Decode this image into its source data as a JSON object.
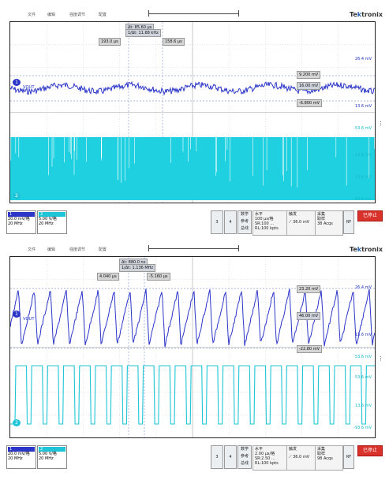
{
  "menu": [
    "文件",
    "编辑",
    "强度调节",
    "配置"
  ],
  "brand": {
    "prefix": "Te",
    "mark": "k",
    "suffix": "tronix"
  },
  "scopes": [
    {
      "delta_time": "Δt: 85.60 μs",
      "delta_freq": "1/Δt: 11.68 kHz",
      "cursor_a": "193.0 μs",
      "cursor_b": "158.6 μs",
      "v_a": "9.200 mV",
      "v_b": "-6.800 mV",
      "dv": "16.00 mV",
      "dv_dt": "ΔV/Δt",
      "ch1_name": "VOUT",
      "ch2_name": "CH2",
      "right_labels": [
        "26.4 mV",
        "Δt",
        "13.6 mV",
        "-53.6 mV",
        "-13.6 mV",
        "-13.6 mV",
        "-93.6 mV"
      ],
      "ch1": {
        "label": "20.0 mV/格",
        "bw": "20 MHz"
      },
      "ch2": {
        "label": "5.00 V/格",
        "bw": "20 MHz"
      },
      "btn3": "3",
      "btn4": "4",
      "math": [
        "数学",
        "参考",
        "总线"
      ],
      "horizontal": [
        "水平",
        "100 μs/格",
        "SR:100 ...",
        "RL:100 kpts"
      ],
      "trigger": [
        "触发",
        "36.0 mV"
      ],
      "acq": [
        "采集",
        "取样",
        "38 Acqs"
      ],
      "rf": "RF",
      "stop": "已停止"
    },
    {
      "delta_time": "Δt: 880.0 ns",
      "delta_freq": "1/Δt: 1.136 MHz",
      "cursor_a": "4.040 μs",
      "cursor_b": "-5.160 μs",
      "v_a": "23.20 mV",
      "v_b": "-22.80 mV",
      "dv": "46.00 mV",
      "dv_dt": "ΔV/Δt",
      "ch1_name": "VOUT",
      "ch2_name": "CH2",
      "right_labels": [
        "26.4 mV",
        "Δt",
        "13.6 mV",
        "53.6 mV",
        "53.6 mV",
        "13.6 mV",
        "-93.6 mV"
      ],
      "ch1": {
        "label": "20.0 mV/格",
        "bw": "20 MHz"
      },
      "ch2": {
        "label": "5.00 V/格",
        "bw": "20 MHz"
      },
      "btn3": "3",
      "btn4": "4",
      "math": [
        "数学",
        "参考",
        "总线"
      ],
      "horizontal": [
        "水平",
        "2.00 μs/格",
        "SR:2.50 ...",
        "RL:100 kpts"
      ],
      "trigger": [
        "触发",
        "36.0 mV"
      ],
      "acq": [
        "采集",
        "取样",
        "98 Acqs"
      ],
      "rf": "RF",
      "stop": "已停止"
    }
  ],
  "colors": {
    "ch1": "#2b35c8",
    "ch2": "#1fc5d6",
    "stop": "#d8322a"
  }
}
